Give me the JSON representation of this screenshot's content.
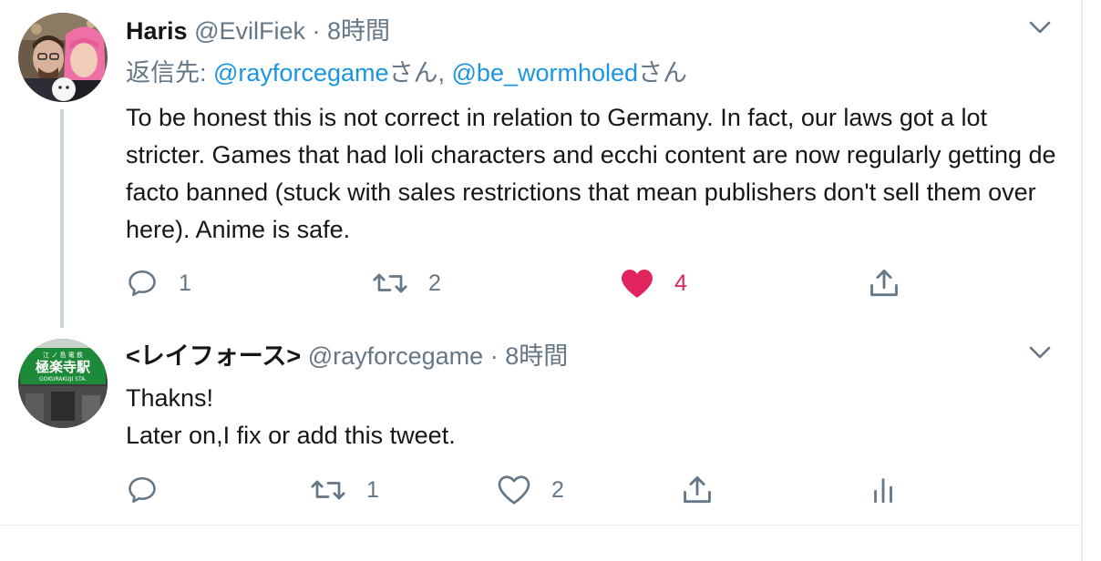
{
  "tweets": [
    {
      "display_name": "Haris",
      "handle": "@EvilFiek",
      "separator": "·",
      "time": "8時間",
      "reply_prefix": "返信先: ",
      "reply_mentions": [
        {
          "mention": "@rayforcegame",
          "suffix": "さん"
        },
        {
          "mention": "@be_wormholed",
          "suffix": "さん"
        }
      ],
      "reply_comma": ", ",
      "text": "To be honest this is not correct in relation to Germany. In fact, our laws got a lot stricter. Games that had loli characters and ecchi content are now regularly getting de facto banned (stuck with sales restrictions that mean publishers don't sell them over here). Anime is safe.",
      "actions": {
        "reply_count": "1",
        "retweet_count": "2",
        "like_count": "4",
        "liked": true
      }
    },
    {
      "display_name": "<レイフォース>",
      "handle": "@rayforcegame",
      "separator": "·",
      "time": "8時間",
      "text_lines": [
        "Thakns!",
        "Later on,I fix or add this tweet."
      ],
      "actions": {
        "reply_count": "",
        "retweet_count": "1",
        "like_count": "2",
        "liked": false
      },
      "avatar_sign": {
        "line1": "江 ノ 島 電 鉄",
        "line2": "極楽寺駅",
        "line3": "GOKURAKUJI STA."
      }
    }
  ],
  "colors": {
    "text": "#14171a",
    "secondary": "#657786",
    "link": "#1b95e0",
    "like": "#e0245e",
    "icon": "#657786",
    "divider": "#e6ecf0"
  },
  "icons": [
    "reply-icon",
    "retweet-icon",
    "like-icon",
    "share-icon",
    "analytics-icon",
    "chevron-down-icon"
  ]
}
